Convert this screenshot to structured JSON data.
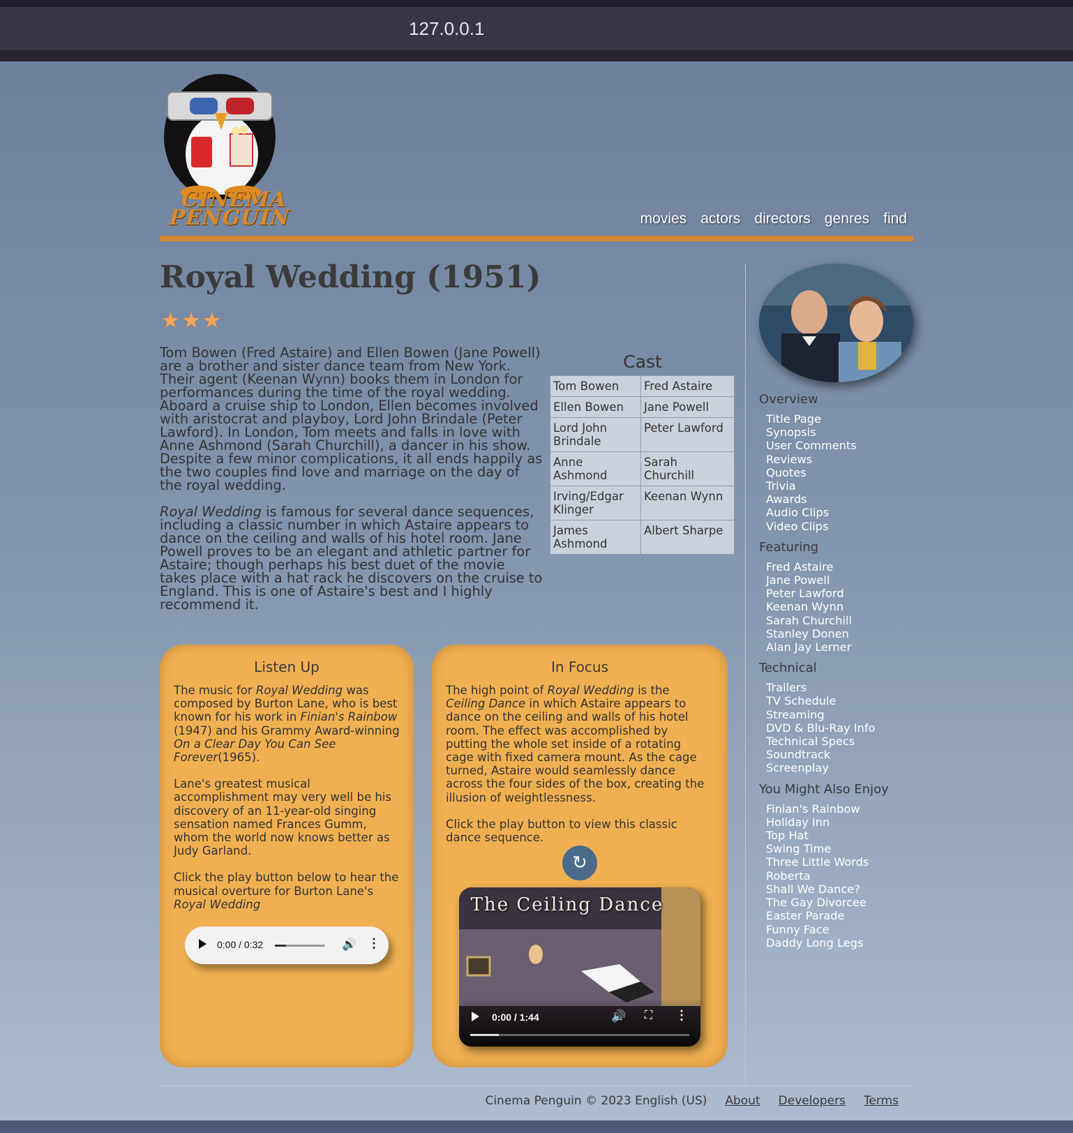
{
  "browser": {
    "url": "127.0.0.1"
  },
  "header": {
    "logo_text": "CINEMA PENGUIN",
    "nav": [
      "movies",
      "actors",
      "directors",
      "genres",
      "find"
    ]
  },
  "movie": {
    "title": "Royal Wedding (1951)",
    "rating": 3,
    "rating_stars": "★★★",
    "synopsis_p1": "Tom Bowen (Fred Astaire) and Ellen Bowen (Jane Powell) are a brother and sister dance team from New York. Their agent (Keenan Wynn) books them in London for performances during the time of the royal wedding. Aboard a cruise ship to London, Ellen becomes involved with aristocrat and playboy, Lord John Brindale (Peter Lawford). In London, Tom meets and falls in love with Anne Ashmond (Sarah Churchill), a dancer in his show. Despite a few minor complications, it all ends happily as the two couples find love and marriage on the day of the royal wedding.",
    "synopsis_p2_title": "Royal Wedding",
    "synopsis_p2_rest": " is famous for several dance sequences, including a classic number in which Astaire appears to dance on the ceiling and walls of his hotel room. Jane Powell proves to be an elegant and athletic partner for Astaire; though perhaps his best duet of the movie takes place with a hat rack he discovers on the cruise to England. This is one of Astaire's best and I highly recommend it."
  },
  "cast": {
    "title": "Cast",
    "rows": [
      [
        "Tom Bowen",
        "Fred Astaire"
      ],
      [
        "Ellen Bowen",
        "Jane Powell"
      ],
      [
        "Lord John Brindale",
        "Peter Lawford"
      ],
      [
        "Anne Ashmond",
        "Sarah Churchill"
      ],
      [
        "Irving/Edgar Klinger",
        "Keenan Wynn"
      ],
      [
        "James Ashmond",
        "Albert Sharpe"
      ]
    ]
  },
  "sidebar": {
    "sections": [
      {
        "heading": "Overview",
        "items": [
          "Title Page",
          "Synopsis",
          "User Comments",
          "Reviews",
          "Quotes",
          "Trivia",
          "Awards",
          "Audio Clips",
          "Video Clips"
        ]
      },
      {
        "heading": "Featuring",
        "items": [
          "Fred Astaire",
          "Jane Powell",
          "Peter Lawford",
          "Keenan Wynn",
          "Sarah Churchill",
          "Stanley Donen",
          "Alan Jay Lerner"
        ]
      },
      {
        "heading": "Technical",
        "items": [
          "Trailers",
          "TV Schedule",
          "Streaming",
          "DVD & Blu-Ray Info",
          "Technical Specs",
          "Soundtrack",
          "Screenplay"
        ]
      },
      {
        "heading": "You Might Also Enjoy",
        "items": [
          "Finian's Rainbow",
          "Holiday Inn",
          "Top Hat",
          "Swing Time",
          "Three Little Words",
          "Roberta",
          "Shall We Dance?",
          "The Gay Divorcee",
          "Easter Parade",
          "Funny Face",
          "Daddy Long Legs"
        ]
      }
    ]
  },
  "listen_up": {
    "heading": "Listen Up",
    "p1_a": "The music for ",
    "p1_b": "Royal Wedding",
    "p1_c": " was composed by Burton Lane, who is best known for his work in ",
    "p1_d": "Finian's Rainbow",
    "p1_e": " (1947) and his Grammy Award-winning ",
    "p1_f": "On a Clear Day You Can See Forever",
    "p1_g": "(1965).",
    "p2": "Lane's greatest musical accomplishment may very well be his discovery of an 11-year-old singing sensation named Frances Gumm, whom the world now knows better as Judy Garland.",
    "p3_a": "Click the play button below to hear the musical overture for Burton Lane's ",
    "p3_b": "Royal Wedding",
    "audio": {
      "time": "0:00 / 0:32",
      "progress": 0.22
    }
  },
  "in_focus": {
    "heading": "In Focus",
    "p1_a": "The high point of ",
    "p1_b": "Royal Wedding",
    "p1_c": " is the ",
    "p1_d": "Ceiling Dance",
    "p1_e": " in which Astaire appears to dance on the ceiling and walls of his hotel room. The effect was accomplished by putting the whole set inside of a rotating cage with fixed camera mount. As the cage turned, Astaire would seamlessly dance across the four sides of the box, creating the illusion of weightlessness.",
    "p2": "Click the play button to view this classic dance sequence.",
    "replay_icon": "↻",
    "video": {
      "title": "The Ceiling Dance",
      "time": "0:00 / 1:44",
      "progress": 0.13
    }
  },
  "footer": {
    "copyright": "Cinema Penguin © 2023 English (US)",
    "links": [
      "About",
      "Developers",
      "Terms"
    ]
  },
  "colors": {
    "accent": "#d4882f",
    "card": "#f0b052",
    "link": "#ffffff"
  }
}
